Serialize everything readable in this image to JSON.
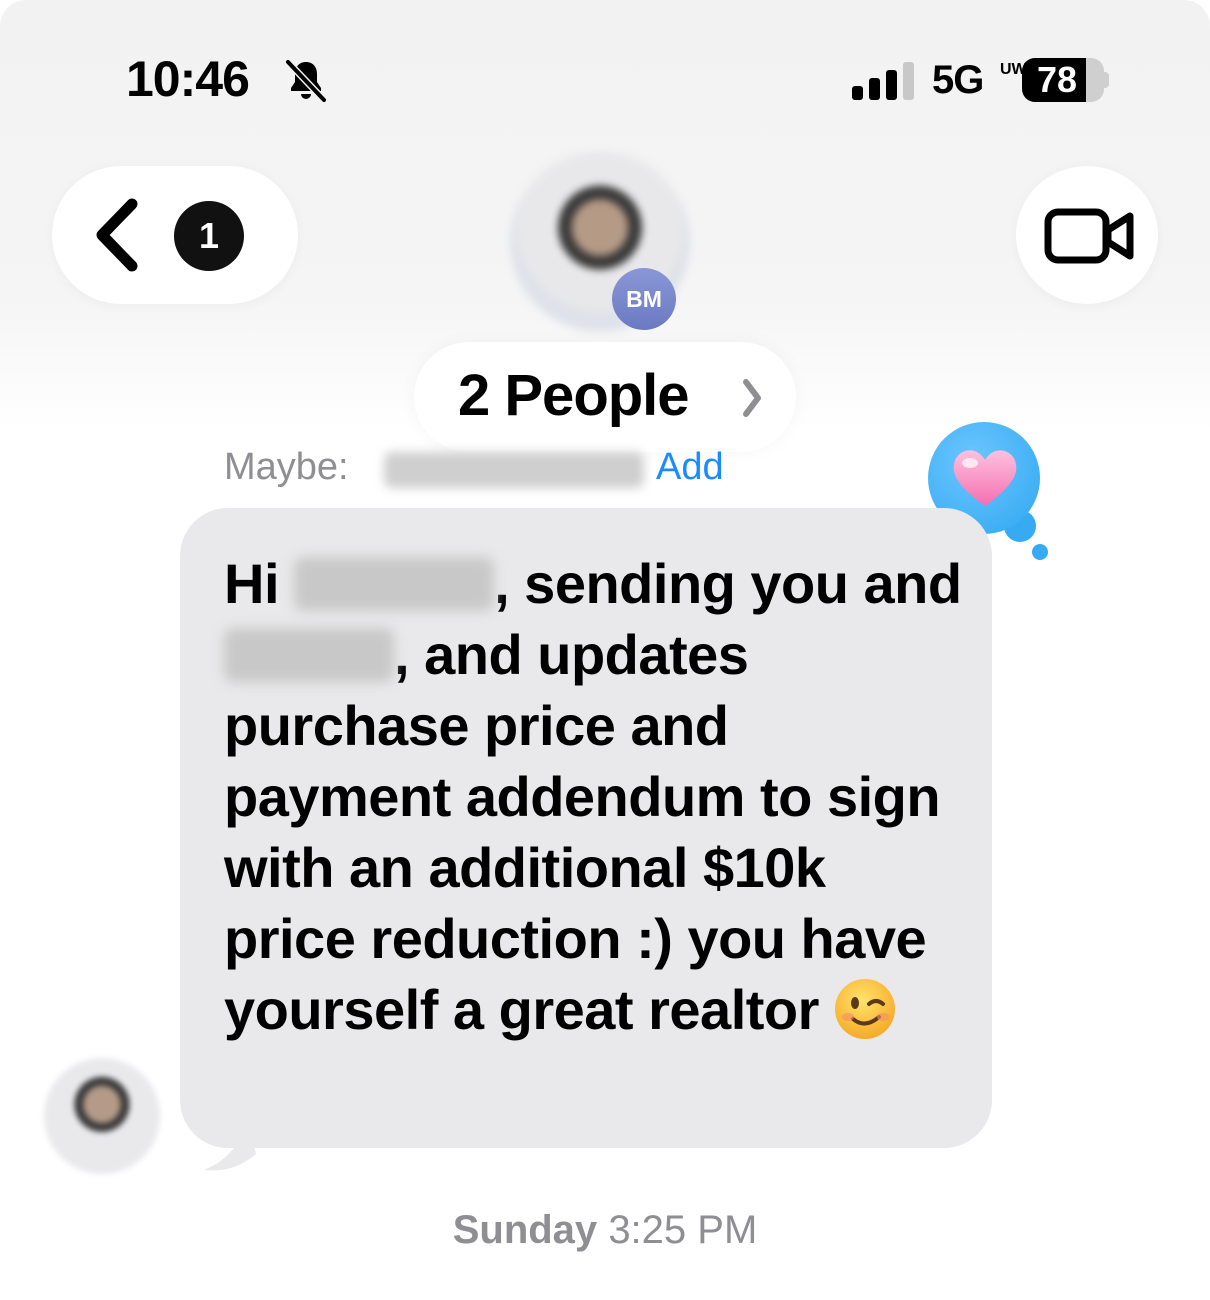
{
  "status_bar": {
    "time": "10:46",
    "network": "5G",
    "network_suffix": "UW",
    "battery_level": 78,
    "battery_text": "78"
  },
  "nav": {
    "unread_count": "1",
    "avatar_initials": "BM"
  },
  "conversation": {
    "title": "2 People",
    "maybe_label": "Maybe:",
    "add_label": "Add",
    "message_parts": [
      "Hi ",
      ", sending you and ",
      ", and updates purchase price and payment addendum to sign with an additional $10k price reduction :) you have yourself a great realtor"
    ],
    "tapback": "heart",
    "timestamp_day": "Sunday",
    "timestamp_time": "3:25 PM"
  },
  "colors": {
    "accent": "#1a8cff",
    "bubble": "#e9e9eb",
    "tapback": "#2fa7f0",
    "secondary_text": "#8e8e93"
  },
  "icons": [
    "bell-slash-icon",
    "signal-icon",
    "battery-icon",
    "back-chevron-icon",
    "video-camera-icon",
    "chevron-right-icon",
    "heart-icon",
    "winking-face-emoji"
  ]
}
